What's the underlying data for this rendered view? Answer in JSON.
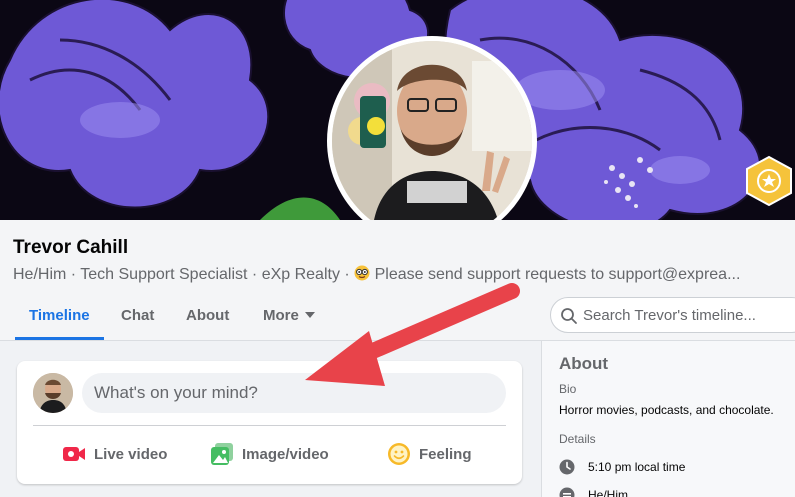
{
  "profile": {
    "name": "Trevor Cahill",
    "headline": "He/Him · Tech Support Specialist · eXp Realty · ",
    "headline_message": "Please send support requests to support@exprea..."
  },
  "tabs": [
    {
      "label": "Timeline",
      "active": true
    },
    {
      "label": "Chat",
      "active": false
    },
    {
      "label": "About",
      "active": false
    },
    {
      "label": "More",
      "active": false
    }
  ],
  "search": {
    "placeholder": "Search Trevor's timeline..."
  },
  "composer": {
    "prompt": "What's on your mind?",
    "actions": [
      {
        "label": "Live video",
        "icon": "live-video-icon",
        "color": "#f02849"
      },
      {
        "label": "Image/video",
        "icon": "photo-icon",
        "color": "#45bd62"
      },
      {
        "label": "Feeling",
        "icon": "feeling-icon",
        "color": "#f7b928"
      }
    ]
  },
  "about": {
    "title": "About",
    "bio_label": "Bio",
    "bio": "Horror movies, podcasts, and chocolate.",
    "details_label": "Details",
    "local_time": "5:10 pm local time",
    "pronouns": "He/Him"
  },
  "colors": {
    "accent": "#1b74e4",
    "badge": "#f5c33b",
    "annotation_arrow": "#e8434a"
  }
}
